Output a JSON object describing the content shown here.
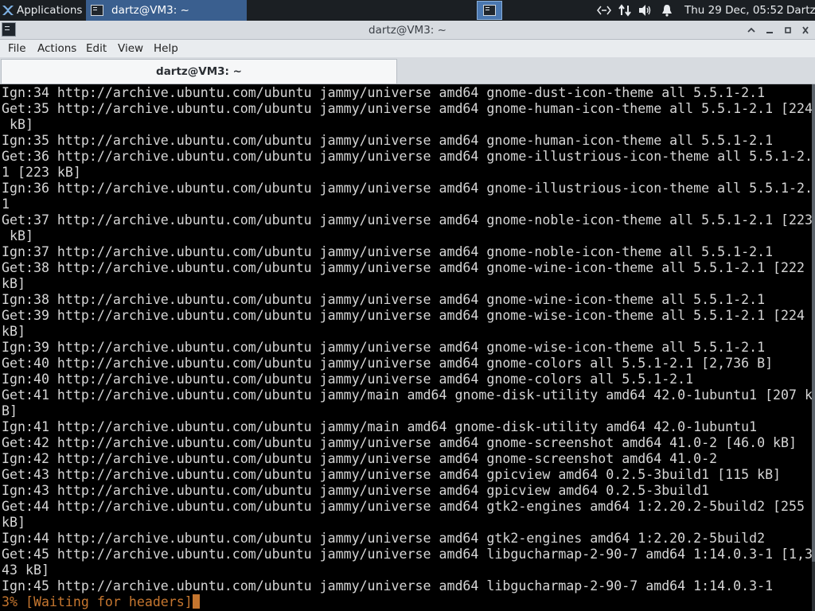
{
  "panel": {
    "applications_label": "Applications",
    "task_label": "dartz@VM3: ~",
    "clock": "Thu 29 Dec, 05:52",
    "user": "Dartz"
  },
  "window": {
    "title": "dartz@VM3: ~",
    "menu": [
      "File",
      "Actions",
      "Edit",
      "View",
      "Help"
    ],
    "tab_label": "dartz@VM3: ~"
  },
  "terminal": {
    "lines": [
      "Ign:34 http://archive.ubuntu.com/ubuntu jammy/universe amd64 gnome-dust-icon-theme all 5.5.1-2.1",
      "Get:35 http://archive.ubuntu.com/ubuntu jammy/universe amd64 gnome-human-icon-theme all 5.5.1-2.1 [224",
      " kB]",
      "Ign:35 http://archive.ubuntu.com/ubuntu jammy/universe amd64 gnome-human-icon-theme all 5.5.1-2.1",
      "Get:36 http://archive.ubuntu.com/ubuntu jammy/universe amd64 gnome-illustrious-icon-theme all 5.5.1-2.",
      "1 [223 kB]",
      "Ign:36 http://archive.ubuntu.com/ubuntu jammy/universe amd64 gnome-illustrious-icon-theme all 5.5.1-2.",
      "1",
      "Get:37 http://archive.ubuntu.com/ubuntu jammy/universe amd64 gnome-noble-icon-theme all 5.5.1-2.1 [223",
      " kB]",
      "Ign:37 http://archive.ubuntu.com/ubuntu jammy/universe amd64 gnome-noble-icon-theme all 5.5.1-2.1",
      "Get:38 http://archive.ubuntu.com/ubuntu jammy/universe amd64 gnome-wine-icon-theme all 5.5.1-2.1 [222",
      "kB]",
      "Ign:38 http://archive.ubuntu.com/ubuntu jammy/universe amd64 gnome-wine-icon-theme all 5.5.1-2.1",
      "Get:39 http://archive.ubuntu.com/ubuntu jammy/universe amd64 gnome-wise-icon-theme all 5.5.1-2.1 [224",
      "kB]",
      "Ign:39 http://archive.ubuntu.com/ubuntu jammy/universe amd64 gnome-wise-icon-theme all 5.5.1-2.1",
      "Get:40 http://archive.ubuntu.com/ubuntu jammy/universe amd64 gnome-colors all 5.5.1-2.1 [2,736 B]",
      "Ign:40 http://archive.ubuntu.com/ubuntu jammy/universe amd64 gnome-colors all 5.5.1-2.1",
      "Get:41 http://archive.ubuntu.com/ubuntu jammy/main amd64 gnome-disk-utility amd64 42.0-1ubuntu1 [207 k",
      "B]",
      "Ign:41 http://archive.ubuntu.com/ubuntu jammy/main amd64 gnome-disk-utility amd64 42.0-1ubuntu1",
      "Get:42 http://archive.ubuntu.com/ubuntu jammy/universe amd64 gnome-screenshot amd64 41.0-2 [46.0 kB]",
      "Ign:42 http://archive.ubuntu.com/ubuntu jammy/universe amd64 gnome-screenshot amd64 41.0-2",
      "Get:43 http://archive.ubuntu.com/ubuntu jammy/universe amd64 gpicview amd64 0.2.5-3build1 [115 kB]",
      "Ign:43 http://archive.ubuntu.com/ubuntu jammy/universe amd64 gpicview amd64 0.2.5-3build1",
      "Get:44 http://archive.ubuntu.com/ubuntu jammy/universe amd64 gtk2-engines amd64 1:2.20.2-5build2 [255",
      "kB]",
      "Ign:44 http://archive.ubuntu.com/ubuntu jammy/universe amd64 gtk2-engines amd64 1:2.20.2-5build2",
      "Get:45 http://archive.ubuntu.com/ubuntu jammy/universe amd64 libgucharmap-2-90-7 amd64 1:14.0.3-1 [1,3",
      "43 kB]",
      "Ign:45 http://archive.ubuntu.com/ubuntu jammy/universe amd64 libgucharmap-2-90-7 amd64 1:14.0.3-1"
    ],
    "status_line": "3% [Waiting for headers]"
  },
  "colors": {
    "panel_bg": "#1b1f23",
    "task_active": "#3a5f8f",
    "terminal_bg": "#000000",
    "terminal_fg": "#d6d6d6",
    "status_fg": "#c5762f"
  }
}
